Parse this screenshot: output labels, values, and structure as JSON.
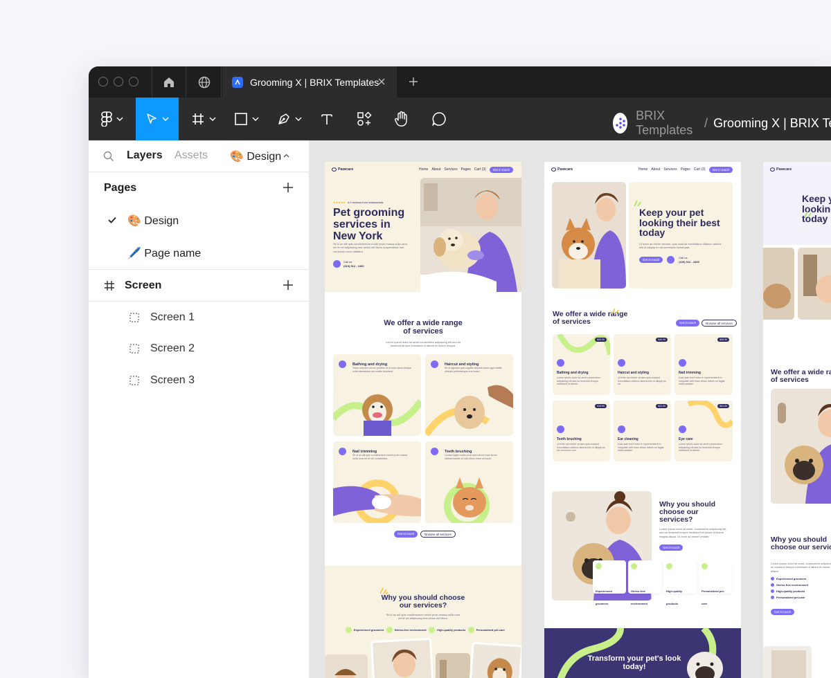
{
  "tab": {
    "title": "Grooming X | BRIX Templates"
  },
  "breadcrumb": {
    "team": "BRIX Templates",
    "separator": "/",
    "file": "Grooming X | BRIX Templates"
  },
  "panel": {
    "tabs": {
      "layers": "Layers",
      "assets": "Assets",
      "page": "🎨 Design"
    },
    "pages_title": "Pages",
    "pages": [
      {
        "label": "🎨 Design"
      },
      {
        "label": "🖊️ Page name"
      }
    ],
    "screen_title": "Screen",
    "layers": [
      {
        "label": "Screen 1"
      },
      {
        "label": "Screen 2"
      },
      {
        "label": "Screen 3"
      }
    ]
  },
  "screen1": {
    "brand": "Pawcare",
    "nav": [
      "Home",
      "About",
      "Services",
      "Pages",
      "Cart (3)"
    ],
    "nav_cta": "Get in touch",
    "rating": "4.9 reviews from testimonials",
    "hero_title": "Pet grooming services in New York",
    "hero_text": "Sit id ac alit quis condimentum morbi proin massa nulla urna vel et vel adipiscing sed varius elit libero suspendisse non commodo nunc habitant.",
    "call_label": "Call us",
    "phone": "(319) 512 - 2460",
    "services_title": "We offer a wide range of services",
    "services_text": "Lorem ipsum dolor sit amet consectetur adipiscing elit sed do eiusmod tempor incididunt ut labore et dolore magna.",
    "cards": [
      {
        "title": "Bathing and drying",
        "text": "Tortor ultricies rutrum porttitor ut ut nunc lacus tempor nulla elementum dui mattis hendrerit."
      },
      {
        "title": "Haircut and styling",
        "text": "Sit id egestas quis sagittis ultricies lacus eget mattis ultricies pellentesque orci lorem."
      },
      {
        "title": "Nail trimming",
        "text": "Sit id ac alit quis condimentum morbi proin massa nulla urna vel et vel consectetur."
      },
      {
        "title": "Teeth brushing",
        "text": "Lectus fugiat mollis proin sed rutrum eros lorem ultrices facilisi sit odio libero elem sit amet."
      }
    ],
    "btn_primary": "Get in touch",
    "btn_secondary": "Browse all services",
    "why_title": "Why you should choose our services?",
    "why_text": "Sit id ac alit quis condimentum morbi proin massa nulla urna vel et vel adipiscing sed varius elit libero.",
    "features": [
      "Experienced groomers",
      "Stress-free environment",
      "High-quality products",
      "Personalized pet-care"
    ]
  },
  "screen2": {
    "brand": "Pawcare",
    "nav": [
      "Home",
      "About",
      "Services",
      "Pages",
      "Cart (3)"
    ],
    "nav_cta": "Get in touch",
    "hero_title": "Keep your pet looking their best today",
    "hero_text": "Ut enim ad minim veniam, quis nostrud exercitation ullamco laboris nisi ut aliquip ex ea commodo consequat.",
    "call_label": "Call us",
    "phone": "(319) 512 - 2460",
    "hero_cta": "Get in touch",
    "services_title": "We offer a wide range of services",
    "btn_primary": "Get in touch",
    "btn_secondary": "Browse all services",
    "cards": [
      {
        "title": "Bathing and drying",
        "price": "$25.99",
        "text": "Lorem ipsum dolor sit amet consectetur adipiscing elit sed do eiusmod tempor incididunt ut labore."
      },
      {
        "title": "Haircut and styling",
        "price": "$49.99",
        "text": "Ut enim ad minim veniam quis nostrud exercitation ullamco laboris nisi ut aliquip ex ea."
      },
      {
        "title": "Nail trimming",
        "price": "$45.99",
        "text": "Duis aute irure dolor in reprehenderit in voluptate velit esse cillum dolore eu fugiat nulla pariatur."
      },
      {
        "title": "Teeth brushing",
        "price": "$18.99",
        "text": "Ut enim ad minim veniam quis nostrud exercitation ullamco laboris nisi ut aliquip ex ea commodo con."
      },
      {
        "title": "Ear cleaning",
        "price": "$22.99",
        "text": "Duis aute irure dolor in reprehenderit in voluptate velit esse cillum dolore eu fugiat nulla pariatur."
      },
      {
        "title": "Eye care",
        "price": "$31.99",
        "text": "Lorem ipsum dolor sit amet consectetur adipiscing elit sed do eiusmod tempor incididunt ut labore."
      }
    ],
    "why_title": "Why you should choose our services?",
    "why_text": "Lorem ipsum dolor sit amet, consectetur adipiscing elit, sed do eiusmod tempor incididunt ut labore et dolore magna aliqua. Ut enim ad minim veniam.",
    "why_cta": "Get in touch",
    "features": [
      "Experienced groomers",
      "Stress-free environment",
      "High-quality products",
      "Personalized pet-care"
    ],
    "transform_title": "Transform your pet's look today!"
  },
  "screen3": {
    "brand": "Pawcare",
    "hero_title": "Keep your pet looking their best today",
    "services_title": "We offer a wide range of services",
    "why_title": "Why you should choose our services?",
    "why_text": "Lorem ipsum dolor sit amet, consectetur adipiscing elit, sed do eiusmod tempor incididunt ut labore et dolore magna aliqua.",
    "features": [
      "Experienced groomers",
      "Stress-free environment",
      "High-quality products",
      "Personalized pet-care"
    ],
    "why_cta": "Get in touch"
  },
  "colors": {
    "accent": "#0d99ff",
    "brand_purple": "#7d6cf2",
    "brand_dark": "#2d2a5e",
    "cream": "#f8f2e3",
    "lime": "#c8f08a",
    "yellow": "#ffd36b"
  }
}
